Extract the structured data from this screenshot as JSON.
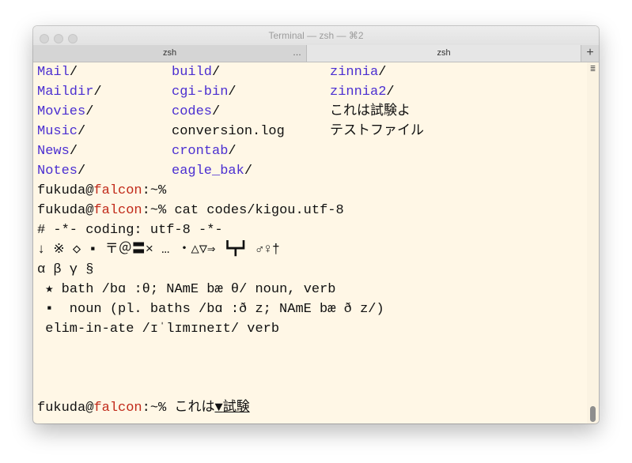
{
  "window": {
    "title": "Terminal — zsh — ⌘2",
    "tabs": [
      {
        "label": "zsh",
        "overflow": "…"
      },
      {
        "label": "zsh"
      }
    ],
    "new_tab_label": "+",
    "scroll_menu_icon": "≣"
  },
  "colors": {
    "background": "#fff7e6",
    "directory": "#4b2fd1",
    "hostname": "#c12a1a",
    "text": "#111111"
  },
  "listing": {
    "col1": [
      {
        "name": "Mail",
        "suffix": "/"
      },
      {
        "name": "Maildir",
        "suffix": "/"
      },
      {
        "name": "Movies",
        "suffix": "/"
      },
      {
        "name": "Music",
        "suffix": "/"
      },
      {
        "name": "News",
        "suffix": "/"
      },
      {
        "name": "Notes",
        "suffix": "/"
      }
    ],
    "col2": [
      {
        "name": "build",
        "suffix": "/"
      },
      {
        "name": "cgi-bin",
        "suffix": "/"
      },
      {
        "name": "codes",
        "suffix": "/"
      },
      {
        "file": "conversion.log"
      },
      {
        "name": "crontab",
        "suffix": "/"
      },
      {
        "name": "eagle_bak",
        "suffix": "/"
      }
    ],
    "col3": [
      {
        "name": "zinnia",
        "suffix": "/"
      },
      {
        "name": "zinnia2",
        "suffix": "/"
      },
      {
        "file": "これは試験よ"
      },
      {
        "file": "テストファイル"
      }
    ]
  },
  "prompt": {
    "user": "fukuda",
    "at": "@",
    "host": "falcon",
    "path": ":~%"
  },
  "commands": [
    "",
    " cat codes/kigou.utf-8"
  ],
  "output": [
    "# -*- coding: utf-8 -*-",
    "↓ ※ ◇ ▪ 〒＠〓× … ・△▽⇒ ┗┳┛ ♂♀†",
    "α β γ §",
    " ★ bath /bɑ :θ; NAmE bæ θ/ noun, verb",
    " ▪  noun (pl. baths /bɑ :ð z; NAmE bæ ð z/)",
    " elim-in-ate /ɪˈlɪmɪneɪt/ verb"
  ],
  "last_input": {
    "typed": " これは",
    "cursor": "▼",
    "preedit": "試験"
  }
}
